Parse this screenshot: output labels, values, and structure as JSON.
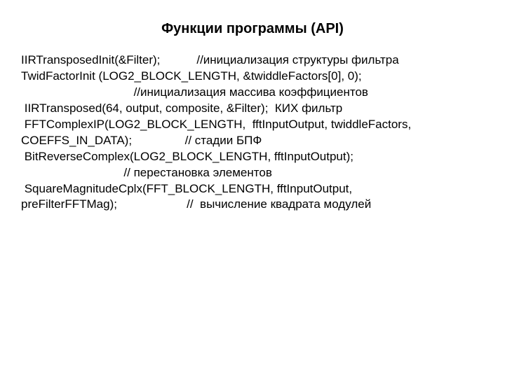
{
  "title": "Функции программы (API)",
  "lines": [
    "IIRTransposedInit(&Filter);           //инициализация структуры фильтра",
    "TwidFactorInit (LOG2_BLOCK_LENGTH, &twiddleFactors[0], 0);",
    "                                  //инициализация массива коэффициентов",
    " IIRTransposed(64, output, composite, &Filter);  КИХ фильтр",
    "",
    " FFTComplexIP(LOG2_BLOCK_LENGTH,  fftInputOutput, twiddleFactors,",
    "COEFFS_IN_DATA);                // стадии БПФ",
    " BitReverseComplex(LOG2_BLOCK_LENGTH, fftInputOutput);",
    "                               // перестановка элементов",
    " SquareMagnitudeCplx(FFT_BLOCK_LENGTH, fftInputOutput,",
    "preFilterFFTMag);                     //  вычисление квадрата модулей"
  ]
}
